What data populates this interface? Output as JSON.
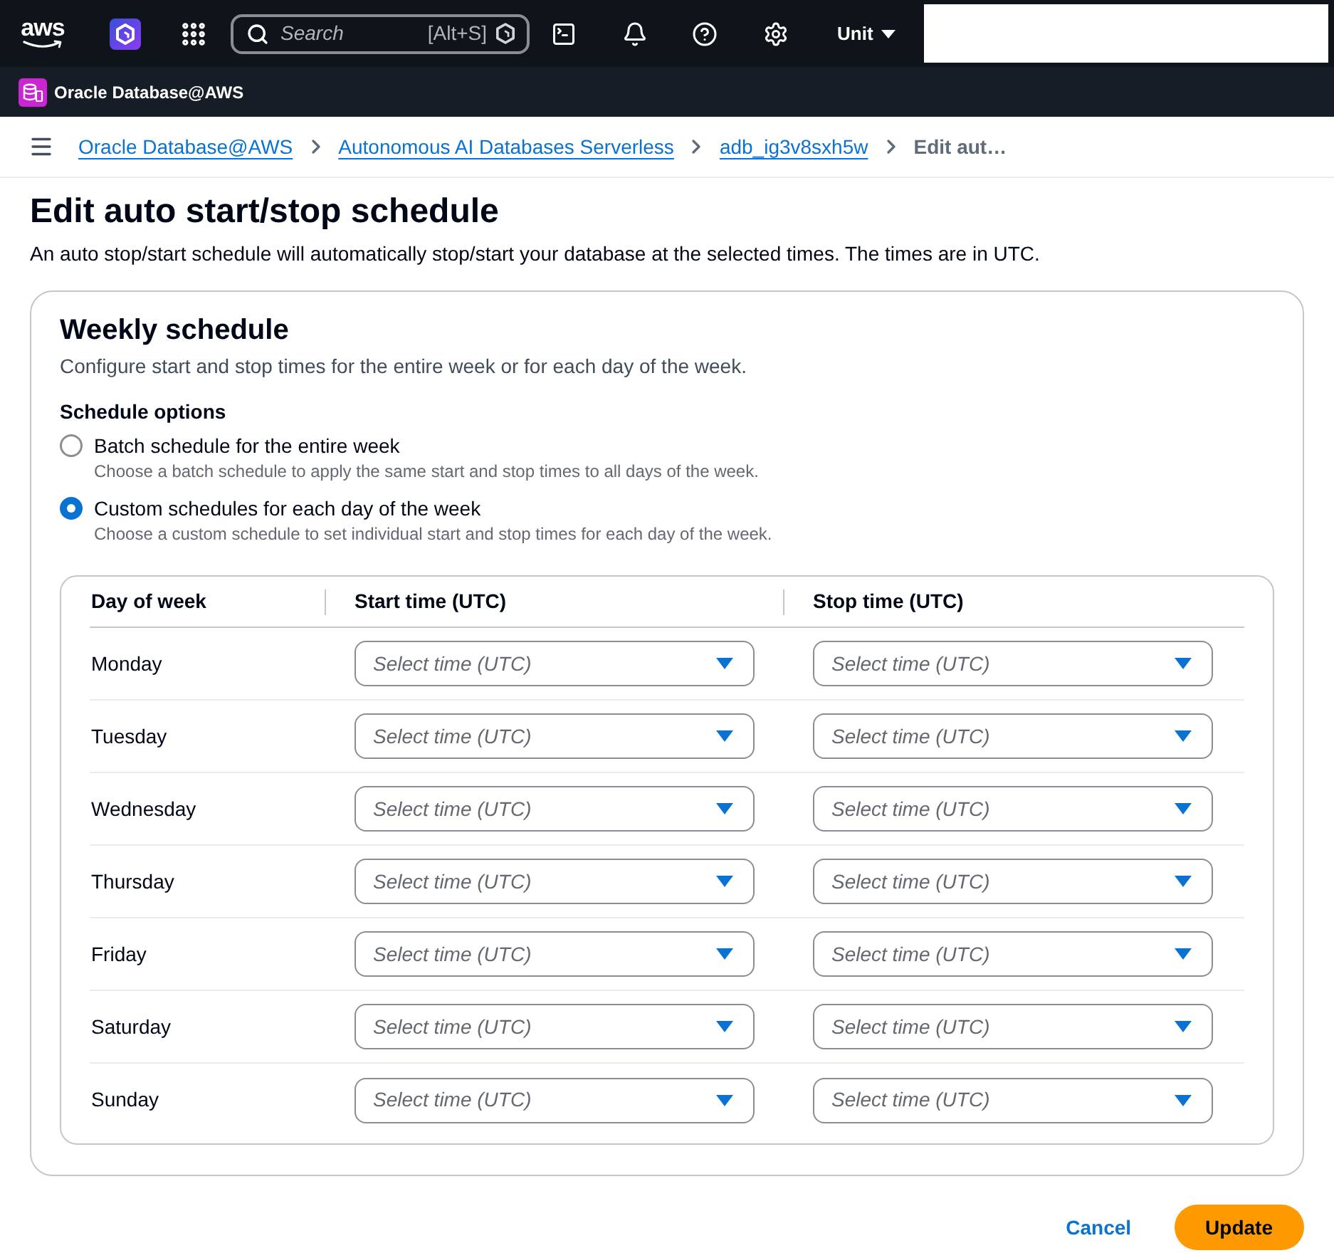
{
  "top_nav": {
    "logo": "aws",
    "search": {
      "placeholder": "Search",
      "shortcut": "[Alt+S]"
    },
    "account_menu": "Unit"
  },
  "service_bar": {
    "title": "Oracle Database@AWS"
  },
  "breadcrumbs": [
    {
      "label": "Oracle Database@AWS",
      "kind": "link"
    },
    {
      "label": "Autonomous AI Databases Serverless",
      "kind": "link"
    },
    {
      "label": "adb_ig3v8sxh5w",
      "kind": "link"
    },
    {
      "label": "Edit aut…",
      "kind": "current"
    }
  ],
  "page": {
    "title": "Edit auto start/stop schedule",
    "description": "An auto stop/start schedule will automatically stop/start your database at the selected times. The times are in UTC."
  },
  "weekly_schedule": {
    "title": "Weekly schedule",
    "description": "Configure start and stop times for the entire week or for each day of the week.",
    "options_label": "Schedule options",
    "options": [
      {
        "label": "Batch schedule for the entire week",
        "description": "Choose a batch schedule to apply the same start and stop times to all days of the week.",
        "selected": false
      },
      {
        "label": "Custom schedules for each day of the week",
        "description": "Choose a custom schedule to set individual start and stop times for each day of the week.",
        "selected": true
      }
    ],
    "table": {
      "columns": [
        "Day of week",
        "Start time (UTC)",
        "Stop time (UTC)"
      ],
      "rows": [
        {
          "day": "Monday",
          "start": {
            "placeholder": "Select time (UTC)"
          },
          "stop": {
            "placeholder": "Select time (UTC)"
          }
        },
        {
          "day": "Tuesday",
          "start": {
            "placeholder": "Select time (UTC)"
          },
          "stop": {
            "placeholder": "Select time (UTC)"
          }
        },
        {
          "day": "Wednesday",
          "start": {
            "placeholder": "Select time (UTC)"
          },
          "stop": {
            "placeholder": "Select time (UTC)"
          }
        },
        {
          "day": "Thursday",
          "start": {
            "placeholder": "Select time (UTC)"
          },
          "stop": {
            "placeholder": "Select time (UTC)"
          }
        },
        {
          "day": "Friday",
          "start": {
            "placeholder": "Select time (UTC)"
          },
          "stop": {
            "placeholder": "Select time (UTC)"
          }
        },
        {
          "day": "Saturday",
          "start": {
            "placeholder": "Select time (UTC)"
          },
          "stop": {
            "placeholder": "Select time (UTC)"
          }
        },
        {
          "day": "Sunday",
          "start": {
            "placeholder": "Select time (UTC)"
          },
          "stop": {
            "placeholder": "Select time (UTC)"
          }
        }
      ]
    }
  },
  "actions": [
    {
      "label": "Cancel",
      "kind": "link"
    },
    {
      "label": "Update",
      "kind": "primary"
    }
  ]
}
